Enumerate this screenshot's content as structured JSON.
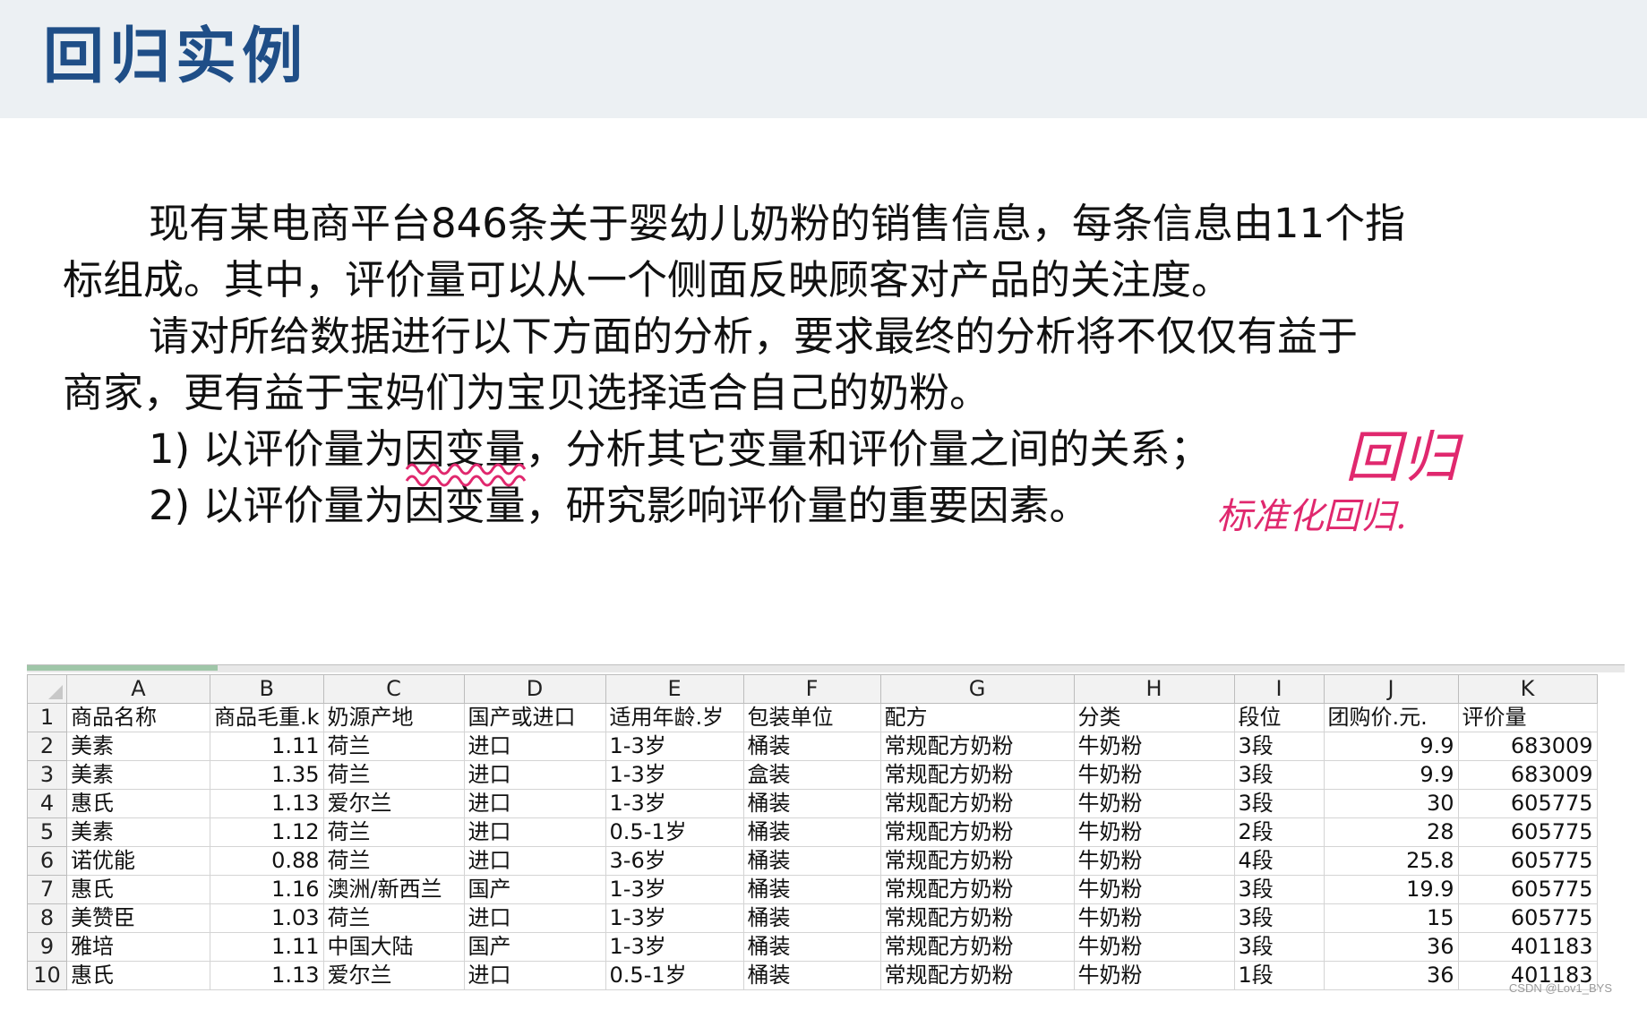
{
  "title": "回归实例",
  "paragraphs": {
    "p1_line1": "现有某电商平台846条关于婴幼儿奶粉的销售信息，每条信息由11个指",
    "p1_line2": "标组成。其中，评价量可以从一个侧面反映顾客对产品的关注度。",
    "p2_line1": "请对所给数据进行以下方面的分析，要求最终的分析将不仅仅有益于",
    "p2_line2": "商家，更有益于宝妈们为宝贝选择适合自己的奶粉。",
    "item1_pre": "1) 以评价量为",
    "item1_hl": "因变量",
    "item1_post": "，分析其它变量和评价量之间的关系；",
    "item2_pre": "2) 以评价量为",
    "item2_hl": "因变量",
    "item2_post": "，研究影响评价量的重要因素。"
  },
  "annotations": {
    "a1": "回归",
    "a2": "标准化回归."
  },
  "colors": {
    "title": "#1f4e87",
    "annotation": "#e0286e",
    "header_bg": "#ecf0f3"
  },
  "spreadsheet": {
    "columns": [
      "A",
      "B",
      "C",
      "D",
      "E",
      "F",
      "G",
      "H",
      "I",
      "J",
      "K"
    ],
    "headers": [
      "商品名称",
      "商品毛重.k",
      "奶源产地",
      "国产或进口",
      "适用年龄.岁",
      "包装单位",
      "配方",
      "分类",
      "段位",
      "团购价.元.",
      "评价量"
    ],
    "rows": [
      [
        "美素",
        "1.11",
        "荷兰",
        "进口",
        "1-3岁",
        "桶装",
        "常规配方奶粉",
        "牛奶粉",
        "3段",
        "9.9",
        "683009"
      ],
      [
        "美素",
        "1.35",
        "荷兰",
        "进口",
        "1-3岁",
        "盒装",
        "常规配方奶粉",
        "牛奶粉",
        "3段",
        "9.9",
        "683009"
      ],
      [
        "惠氏",
        "1.13",
        "爱尔兰",
        "进口",
        "1-3岁",
        "桶装",
        "常规配方奶粉",
        "牛奶粉",
        "3段",
        "30",
        "605775"
      ],
      [
        "美素",
        "1.12",
        "荷兰",
        "进口",
        "0.5-1岁",
        "桶装",
        "常规配方奶粉",
        "牛奶粉",
        "2段",
        "28",
        "605775"
      ],
      [
        "诺优能",
        "0.88",
        "荷兰",
        "进口",
        "3-6岁",
        "桶装",
        "常规配方奶粉",
        "牛奶粉",
        "4段",
        "25.8",
        "605775"
      ],
      [
        "惠氏",
        "1.16",
        "澳洲/新西兰",
        "国产",
        "1-3岁",
        "桶装",
        "常规配方奶粉",
        "牛奶粉",
        "3段",
        "19.9",
        "605775"
      ],
      [
        "美赞臣",
        "1.03",
        "荷兰",
        "进口",
        "1-3岁",
        "桶装",
        "常规配方奶粉",
        "牛奶粉",
        "3段",
        "15",
        "605775"
      ],
      [
        "雅培",
        "1.11",
        "中国大陆",
        "国产",
        "1-3岁",
        "桶装",
        "常规配方奶粉",
        "牛奶粉",
        "3段",
        "36",
        "401183"
      ],
      [
        "惠氏",
        "1.13",
        "爱尔兰",
        "进口",
        "0.5-1岁",
        "桶装",
        "常规配方奶粉",
        "牛奶粉",
        "1段",
        "36",
        "401183"
      ]
    ],
    "numeric_columns": [
      1,
      9,
      10
    ]
  },
  "watermark": "CSDN @Lov1_BYS"
}
